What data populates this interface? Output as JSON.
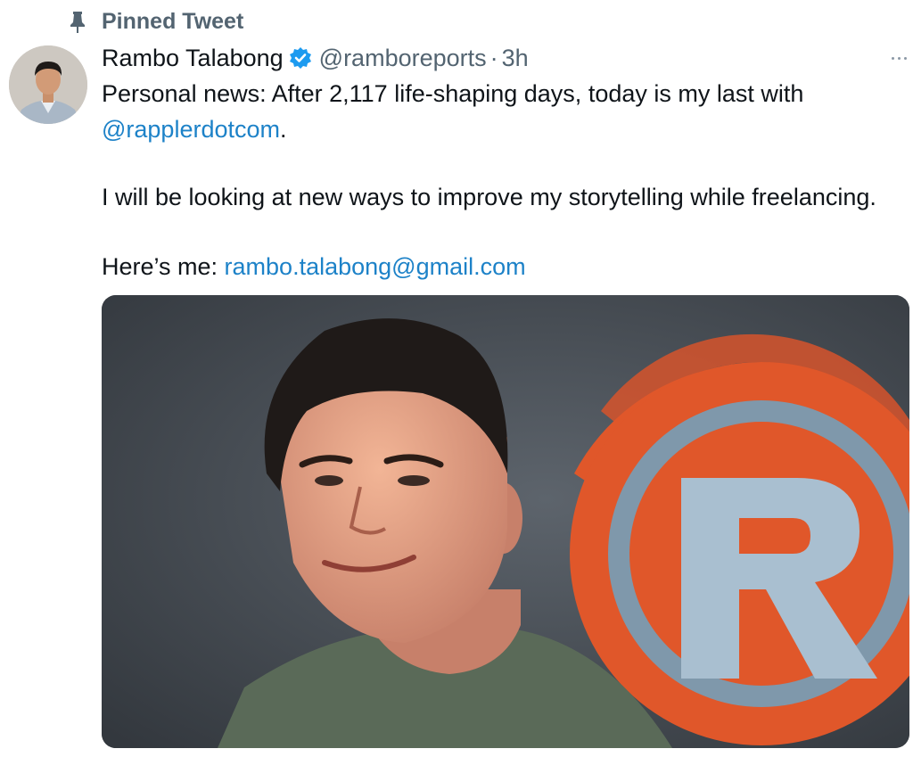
{
  "pinned": {
    "label": "Pinned Tweet",
    "icon": "pin-icon"
  },
  "author": {
    "display_name": "Rambo Talabong",
    "verified_icon": "verified-badge-icon",
    "handle": "@ramboreports",
    "separator": "·",
    "timestamp": "3h"
  },
  "tweet": {
    "line1": "Personal news: After 2,117 life-shaping days, today is my last with",
    "mention": "@rapplerdotcom",
    "mention_suffix": ".",
    "line3": "I will be looking at new ways to improve my storytelling while freelancing.",
    "contact_prefix": "Here’s me: ",
    "email": "rambo.talabong@gmail.com"
  },
  "colors": {
    "link": "#1d82c8",
    "verified": "#1d9bf0",
    "muted": "#536471",
    "logo_orange": "#e0572a"
  }
}
